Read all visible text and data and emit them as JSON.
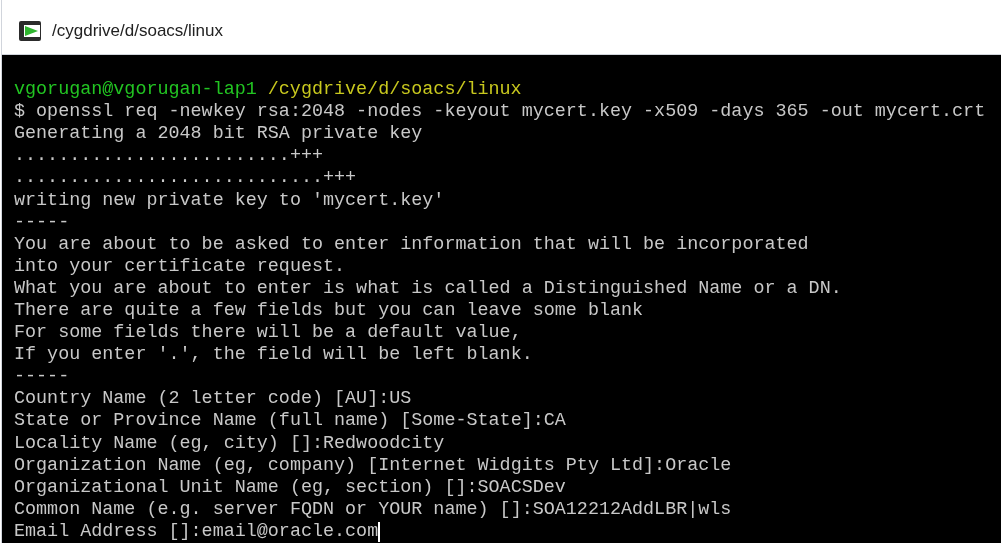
{
  "window": {
    "title": "/cygdrive/d/soacs/linux"
  },
  "prompt": {
    "user_host": "vgorugan@vgorugan-lap1",
    "path": "/cygdrive/d/soacs/linux"
  },
  "lines": [
    "$ openssl req -newkey rsa:2048 -nodes -keyout mycert.key -x509 -days 365 -out mycert.crt",
    "Generating a 2048 bit RSA private key",
    ".........................+++",
    "............................+++",
    "writing new private key to 'mycert.key'",
    "-----",
    "You are about to be asked to enter information that will be incorporated",
    "into your certificate request.",
    "What you are about to enter is what is called a Distinguished Name or a DN.",
    "There are quite a few fields but you can leave some blank",
    "For some fields there will be a default value,",
    "If you enter '.', the field will be left blank.",
    "-----",
    "Country Name (2 letter code) [AU]:US",
    "State or Province Name (full name) [Some-State]:CA",
    "Locality Name (eg, city) []:Redwoodcity",
    "Organization Name (eg, company) [Internet Widgits Pty Ltd]:Oracle",
    "Organizational Unit Name (eg, section) []:SOACSDev",
    "Common Name (e.g. server FQDN or YOUR name) []:SOA12212AddLBR|wls",
    "Email Address []:email@oracle.com"
  ]
}
